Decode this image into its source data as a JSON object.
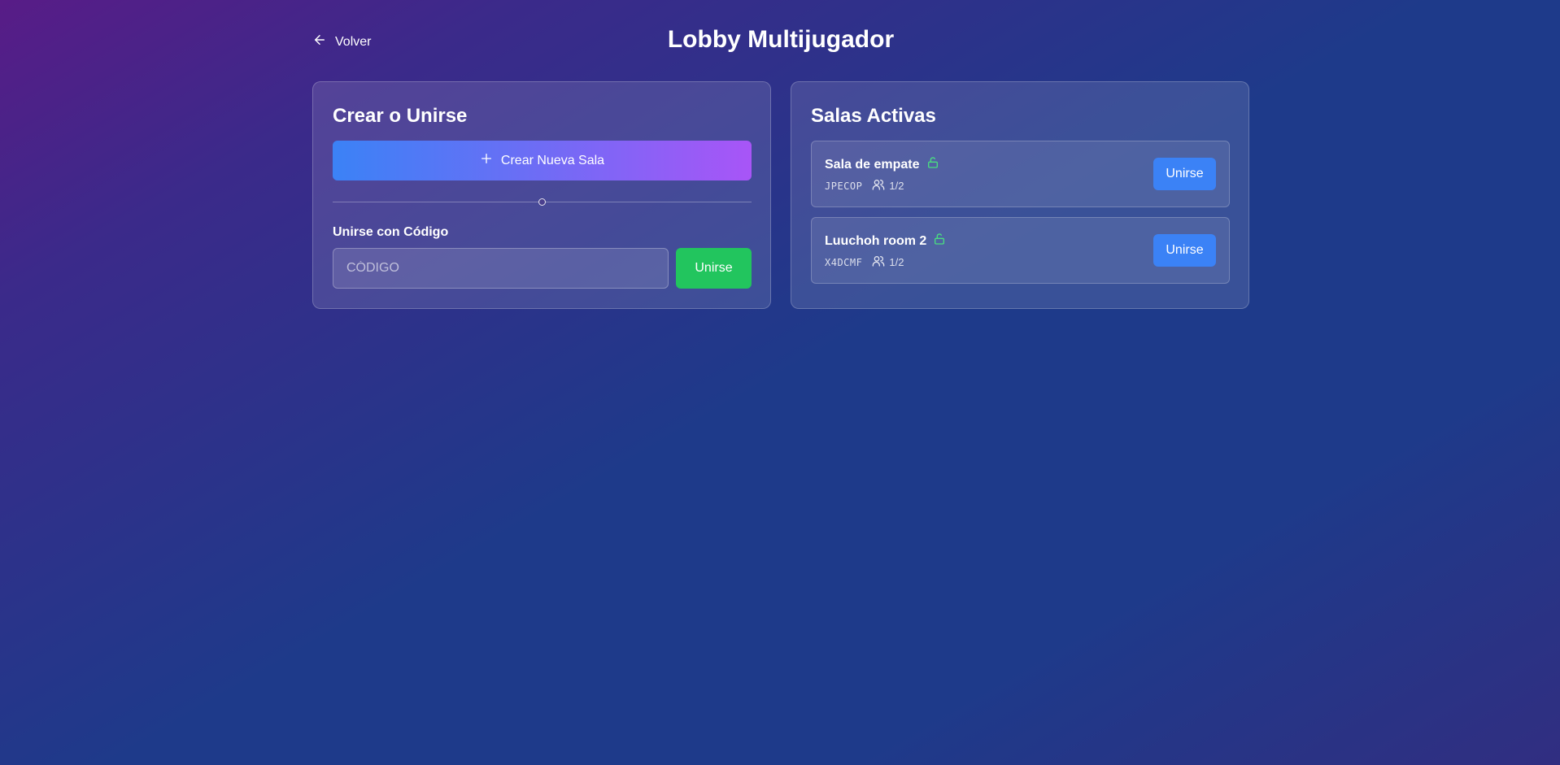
{
  "header": {
    "back_label": "Volver",
    "title": "Lobby Multijugador"
  },
  "create_join": {
    "title": "Crear o Unirse",
    "create_label": "Crear Nueva Sala",
    "join_code_label": "Unirse con Código",
    "code_placeholder": "CÓDIGO",
    "join_button": "Unirse"
  },
  "active_rooms": {
    "title": "Salas Activas",
    "rooms": [
      {
        "name": "Sala de empate",
        "code": "JPECOP",
        "players": "1/2",
        "join_label": "Unirse"
      },
      {
        "name": "Luuchoh room 2",
        "code": "X4DCMF",
        "players": "1/2",
        "join_label": "Unirse"
      }
    ]
  },
  "colors": {
    "accent_blue": "#3b82f6",
    "accent_purple": "#a855f7",
    "success_green": "#22c55e",
    "unlock_icon": "#4ade80"
  },
  "icons": {
    "back": "arrow-left-icon",
    "create": "plus-icon",
    "room_status": "unlock-icon",
    "players": "users-icon"
  }
}
